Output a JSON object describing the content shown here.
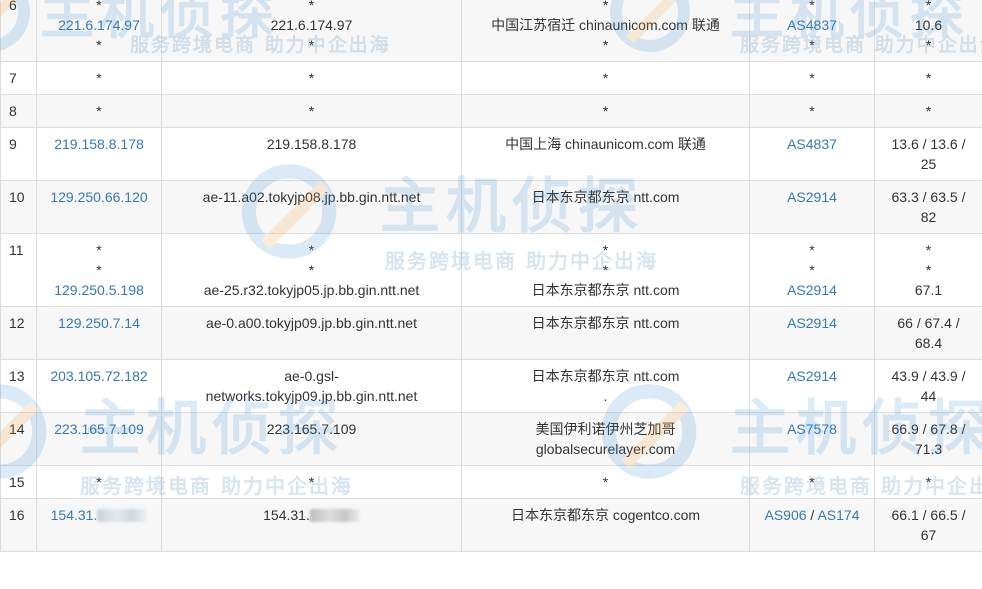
{
  "watermark": {
    "title": "主机侦探",
    "slogan": "服务跨境电商  助力中企出海"
  },
  "rows": [
    {
      "hop": "6",
      "ip": [
        "*",
        "221.6.174.97",
        "*"
      ],
      "host": [
        "*",
        "221.6.174.97",
        "*"
      ],
      "location": [
        "*",
        "中国江苏宿迁 chinaunicom.com 联通",
        "*"
      ],
      "asn": [
        [
          "*"
        ],
        [
          "AS4837"
        ],
        [
          "*"
        ]
      ],
      "latency": [
        "*",
        "10.6",
        "*"
      ]
    },
    {
      "hop": "7",
      "ip": [
        "*"
      ],
      "host": [
        "*"
      ],
      "location": [
        "*"
      ],
      "asn": [
        [
          "*"
        ]
      ],
      "latency": [
        "*"
      ]
    },
    {
      "hop": "8",
      "ip": [
        "*"
      ],
      "host": [
        "*"
      ],
      "location": [
        "*"
      ],
      "asn": [
        [
          "*"
        ]
      ],
      "latency": [
        "*"
      ]
    },
    {
      "hop": "9",
      "ip": [
        "219.158.8.178"
      ],
      "host": [
        "219.158.8.178"
      ],
      "location": [
        "中国上海 chinaunicom.com 联通"
      ],
      "asn": [
        [
          "AS4837"
        ]
      ],
      "latency": [
        "13.6 / 13.6 /",
        "25"
      ]
    },
    {
      "hop": "10",
      "ip": [
        "129.250.66.120"
      ],
      "host": [
        "ae-11.a02.tokyjp08.jp.bb.gin.ntt.net"
      ],
      "location": [
        "日本东京都东京 ntt.com"
      ],
      "asn": [
        [
          "AS2914"
        ]
      ],
      "latency": [
        "63.3 / 63.5 /",
        "82"
      ]
    },
    {
      "hop": "11",
      "ip": [
        "*",
        "*",
        "129.250.5.198"
      ],
      "host": [
        "*",
        "*",
        "ae-25.r32.tokyjp05.jp.bb.gin.ntt.net"
      ],
      "location": [
        "*",
        "*",
        "日本东京都东京 ntt.com"
      ],
      "asn": [
        [
          "*"
        ],
        [
          "*"
        ],
        [
          "AS2914"
        ]
      ],
      "latency": [
        "*",
        "*",
        "67.1"
      ]
    },
    {
      "hop": "12",
      "ip": [
        "129.250.7.14"
      ],
      "host": [
        "ae-0.a00.tokyjp09.jp.bb.gin.ntt.net"
      ],
      "location": [
        "日本东京都东京 ntt.com"
      ],
      "asn": [
        [
          "AS2914"
        ]
      ],
      "latency": [
        "66 / 67.4 /",
        "68.4"
      ]
    },
    {
      "hop": "13",
      "ip": [
        "203.105.72.182"
      ],
      "host": [
        "ae-0.gsl-",
        "networks.tokyjp09.jp.bb.gin.ntt.net"
      ],
      "location": [
        "日本东京都东京 ntt.com",
        "."
      ],
      "asn": [
        [
          "AS2914"
        ]
      ],
      "latency": [
        "43.9 / 43.9 /",
        "44"
      ]
    },
    {
      "hop": "14",
      "ip": [
        "223.165.7.109"
      ],
      "host": [
        "223.165.7.109"
      ],
      "location": [
        "美国伊利诺伊州芝加哥",
        "globalsecurelayer.com"
      ],
      "asn": [
        [
          "AS7578"
        ]
      ],
      "latency": [
        "66.9 / 67.8 /",
        "71.3"
      ]
    },
    {
      "hop": "15",
      "ip": [
        "*"
      ],
      "host": [
        "*"
      ],
      "location": [
        "*"
      ],
      "asn": [
        [
          "*"
        ]
      ],
      "latency": [
        "*"
      ]
    },
    {
      "hop": "16",
      "ip": [
        "154.31."
      ],
      "ip_masked": true,
      "host": [
        "154.31."
      ],
      "host_masked": true,
      "location": [
        "日本东京都东京 cogentco.com"
      ],
      "asn": [
        [
          "AS906",
          "AS174"
        ]
      ],
      "latency": [
        "66.1 / 66.5 /",
        "67"
      ]
    }
  ]
}
